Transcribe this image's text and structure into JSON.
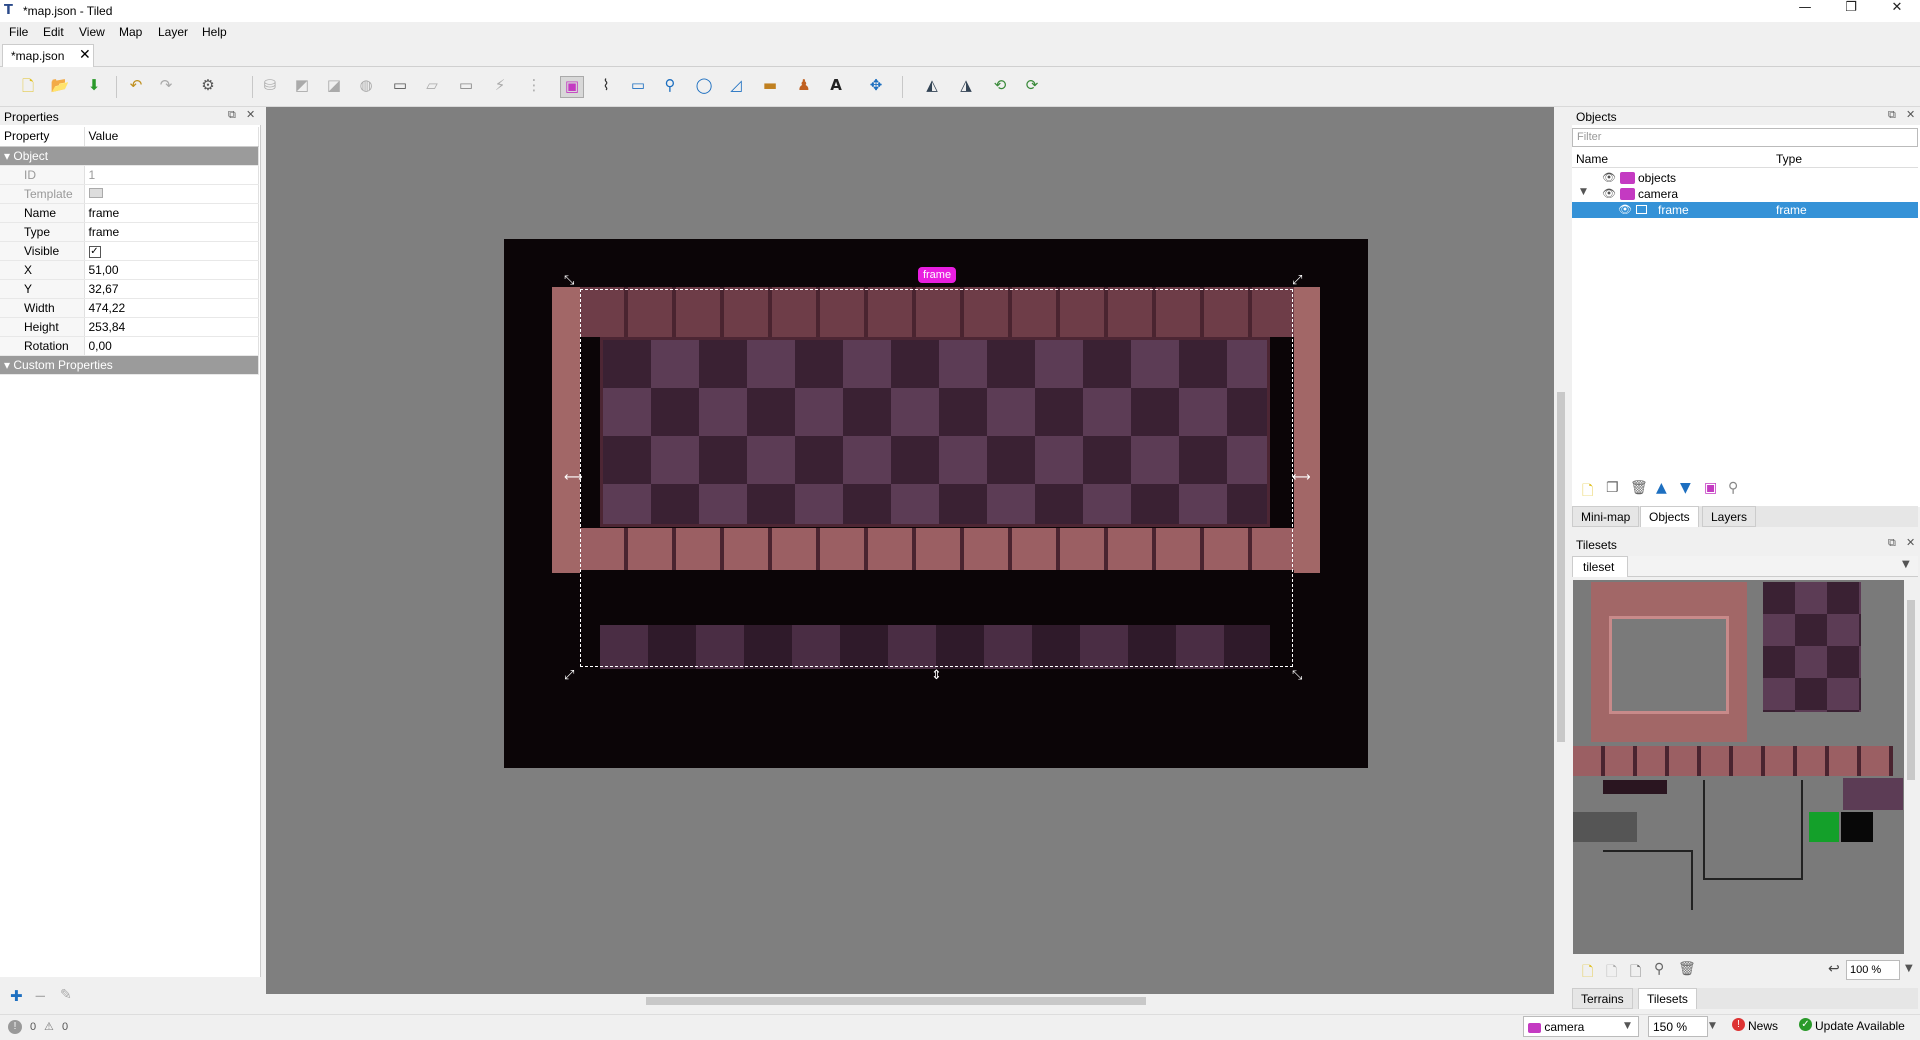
{
  "window": {
    "title": "*map.json - Tiled",
    "minimize": "—",
    "restore": "❐",
    "close": "✕"
  },
  "menu": [
    "File",
    "Edit",
    "View",
    "Map",
    "Layer",
    "Help"
  ],
  "doc_tab": {
    "label": "*map.json",
    "close": "✕"
  },
  "properties": {
    "title": "Properties",
    "col_property": "Property",
    "col_value": "Value",
    "group_object": "Object",
    "rows": [
      {
        "name": "ID",
        "value": "1"
      },
      {
        "name": "Template",
        "value": ""
      },
      {
        "name": "Name",
        "value": "frame"
      },
      {
        "name": "Type",
        "value": "frame"
      },
      {
        "name": "Visible",
        "value": "✓"
      },
      {
        "name": "X",
        "value": "51,00"
      },
      {
        "name": "Y",
        "value": "32,67"
      },
      {
        "name": "Width",
        "value": "474,22"
      },
      {
        "name": "Height",
        "value": "253,84"
      },
      {
        "name": "Rotation",
        "value": "0,00"
      }
    ],
    "group_custom": "Custom Properties"
  },
  "canvas": {
    "selected_object_label": "frame"
  },
  "objects_panel": {
    "title": "Objects",
    "filter_placeholder": "Filter",
    "col_name": "Name",
    "col_type": "Type",
    "rows": [
      {
        "name": "objects",
        "type": ""
      },
      {
        "name": "camera",
        "type": ""
      },
      {
        "name": "frame",
        "type": "frame"
      }
    ],
    "tabs": [
      "Mini-map",
      "Objects",
      "Layers"
    ],
    "active_tab": "Objects"
  },
  "tilesets_panel": {
    "title": "Tilesets",
    "tileset_name": "tileset",
    "zoom": "100 %",
    "tabs": [
      "Terrains",
      "Tilesets"
    ],
    "active_tab": "Tilesets"
  },
  "statusbar": {
    "errors": "0",
    "warnings": "0",
    "current_layer": "camera",
    "zoom": "150 %",
    "news": "News",
    "update": "Update Available"
  },
  "colors": {
    "selection": "#3592d7",
    "object_label": "#e91ee0",
    "layer_icon": "#c43ac2"
  }
}
